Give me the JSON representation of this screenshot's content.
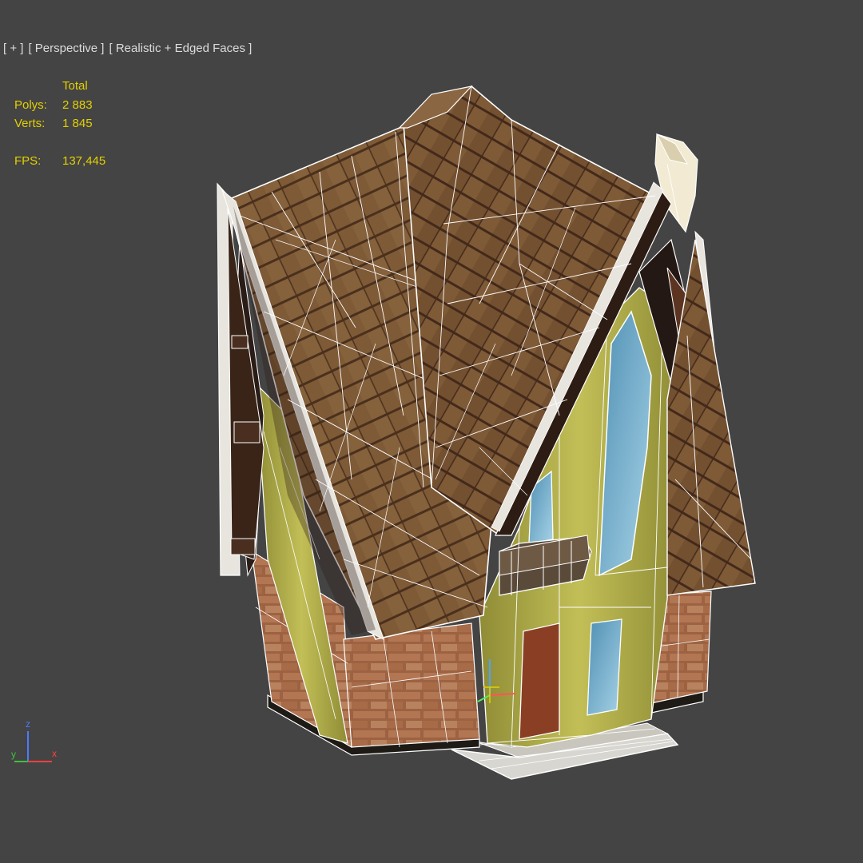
{
  "viewport": {
    "label_plus": "[ + ]",
    "label_view": "[ Perspective ]",
    "label_shading": "[ Realistic + Edged Faces ]"
  },
  "stats": {
    "header": "Total",
    "polys_label": "Polys:",
    "polys_value": "2 883",
    "verts_label": "Verts:",
    "verts_value": "1 845",
    "fps_label": "FPS:",
    "fps_value": "137,445"
  },
  "gizmo": {
    "z": "z",
    "y": "y",
    "x": "x"
  },
  "colors": {
    "background": "#444444",
    "stats_text": "#e3d000",
    "label_text": "#dcdcdc",
    "wire": "#ffffff",
    "roof": "#7a5634",
    "roof_dark": "#3a2318",
    "wall": "#b6b24a",
    "brick": "#a06845",
    "glass": "#7fb3cc"
  }
}
